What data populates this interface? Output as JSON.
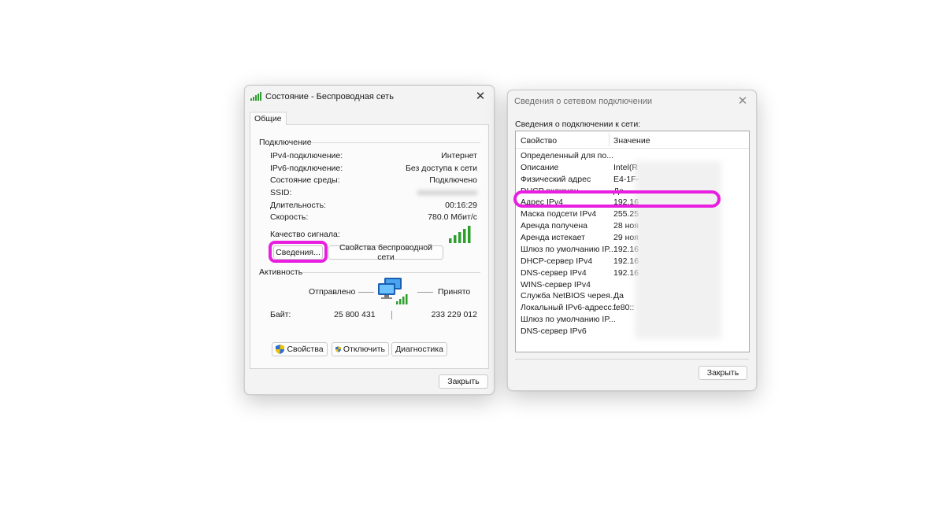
{
  "status_window": {
    "title": "Состояние - Беспроводная сеть",
    "close_glyph": "✕",
    "tab": "Общие",
    "connection": {
      "heading": "Подключение",
      "rows": [
        {
          "label": "IPv4-подключение:",
          "value": "Интернет"
        },
        {
          "label": "IPv6-подключение:",
          "value": "Без доступа к сети"
        },
        {
          "label": "Состояние среды:",
          "value": "Подключено"
        },
        {
          "label": "SSID:",
          "value": "●●●●●●●●●●●●"
        },
        {
          "label": "Длительность:",
          "value": "00:16:29"
        },
        {
          "label": "Скорость:",
          "value": "780.0 Мбит/с"
        }
      ],
      "signal_label": "Качество сигнала:",
      "details_button": "Сведения...",
      "wireless_props_button": "Свойства беспроводной сети"
    },
    "activity": {
      "heading": "Активность",
      "sent_label": "Отправлено",
      "received_label": "Принято",
      "bytes_label": "Байт:",
      "bytes_sent": "25 800 431",
      "bytes_received": "233 229 012"
    },
    "buttons": {
      "properties": "Свойства",
      "disable": "Отключить",
      "diagnostics": "Диагностика",
      "close": "Закрыть"
    }
  },
  "details_window": {
    "title": "Сведения о сетевом подключении",
    "close_glyph": "✕",
    "subtitle": "Сведения о подключении к сети:",
    "columns": [
      "Свойство",
      "Значение"
    ],
    "rows": [
      {
        "property": "Определенный для по...",
        "value": ""
      },
      {
        "property": "Описание",
        "value": "Intel(R"
      },
      {
        "property": "Физический адрес",
        "value": "E4-1F-"
      },
      {
        "property": "DHCP включен",
        "value": "Да"
      },
      {
        "property": "Адрес IPv4",
        "value": "192.16"
      },
      {
        "property": "Маска подсети IPv4",
        "value": "255.25"
      },
      {
        "property": "Аренда получена",
        "value": "28 ноя"
      },
      {
        "property": "Аренда истекает",
        "value": "29 ноя"
      },
      {
        "property": "Шлюз по умолчанию IP...",
        "value": "192.16"
      },
      {
        "property": "DHCP-сервер IPv4",
        "value": "192.16"
      },
      {
        "property": "DNS-сервер IPv4",
        "value": "192.16"
      },
      {
        "property": "WINS-сервер IPv4",
        "value": ""
      },
      {
        "property": "Служба NetBIOS черея...",
        "value": "Да"
      },
      {
        "property": "Локальный IPv6-адресс...",
        "value": "fe80::"
      },
      {
        "property": "Шлюз по умолчанию IP...",
        "value": ""
      },
      {
        "property": "DNS-сервер IPv6",
        "value": ""
      }
    ],
    "close_button": "Закрыть"
  },
  "colors": {
    "highlight": "#e81ee0",
    "signal_green": "#2e9e2e",
    "window_bg": "#f3f3f3"
  }
}
